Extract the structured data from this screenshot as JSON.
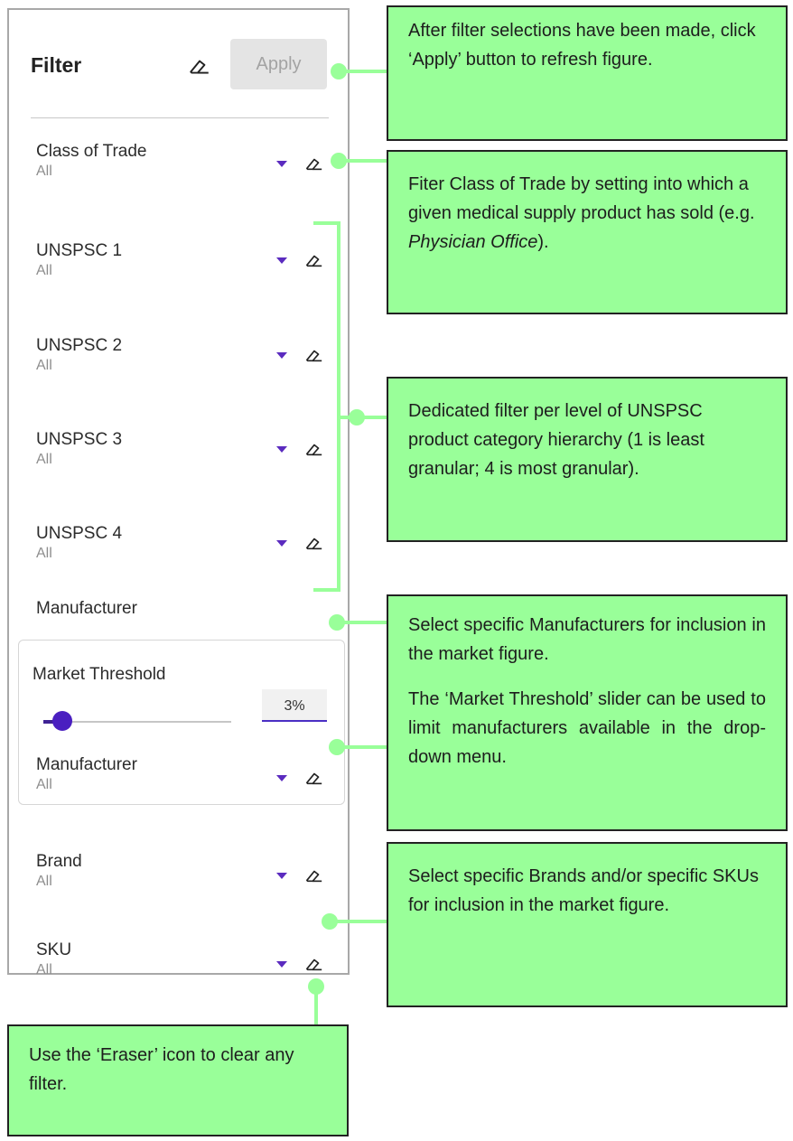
{
  "panel": {
    "title": "Filter",
    "apply_label": "Apply",
    "filters": {
      "class_of_trade": {
        "label": "Class of Trade",
        "value": "All"
      },
      "unspsc1": {
        "label": "UNSPSC 1",
        "value": "All"
      },
      "unspsc2": {
        "label": "UNSPSC 2",
        "value": "All"
      },
      "unspsc3": {
        "label": "UNSPSC 3",
        "value": "All"
      },
      "unspsc4": {
        "label": "UNSPSC 4",
        "value": "All"
      }
    },
    "manufacturer_heading": "Manufacturer",
    "market_threshold": {
      "label": "Market Threshold",
      "value": "3%",
      "slider_fraction": 0.1
    },
    "manufacturer": {
      "label": "Manufacturer",
      "value": "All"
    },
    "brand": {
      "label": "Brand",
      "value": "All"
    },
    "sku": {
      "label": "SKU",
      "value": "All"
    }
  },
  "callouts": {
    "apply": "After filter selections have been made, click ‘Apply’ button to refresh figure.",
    "class_of_trade_pre": "Fiter Class of Trade by setting into which a given medical supply product has sold (e.g. ",
    "class_of_trade_em": "Physician Office",
    "class_of_trade_post": ").",
    "unspsc": "Dedicated filter per level of UNSPSC product category hierarchy (1 is least granular; 4 is most granular).",
    "manufacturer_p1": "Select specific Manufacturers for inclusion in the market figure.",
    "manufacturer_p2": "The ‘Market Threshold’ slider can be used to limit manufacturers available in the drop-down menu.",
    "brand_sku": "Select specific Brands and/or specific SKUs for inclusion in the market figure.",
    "eraser": "Use the ‘Eraser’ icon to clear any filter."
  },
  "colors": {
    "callout_fill": "#99ff99",
    "accent": "#5b2bbf",
    "apply_disabled": "#e4e4e4"
  },
  "icons": [
    "eraser-icon",
    "caret-down-icon"
  ]
}
